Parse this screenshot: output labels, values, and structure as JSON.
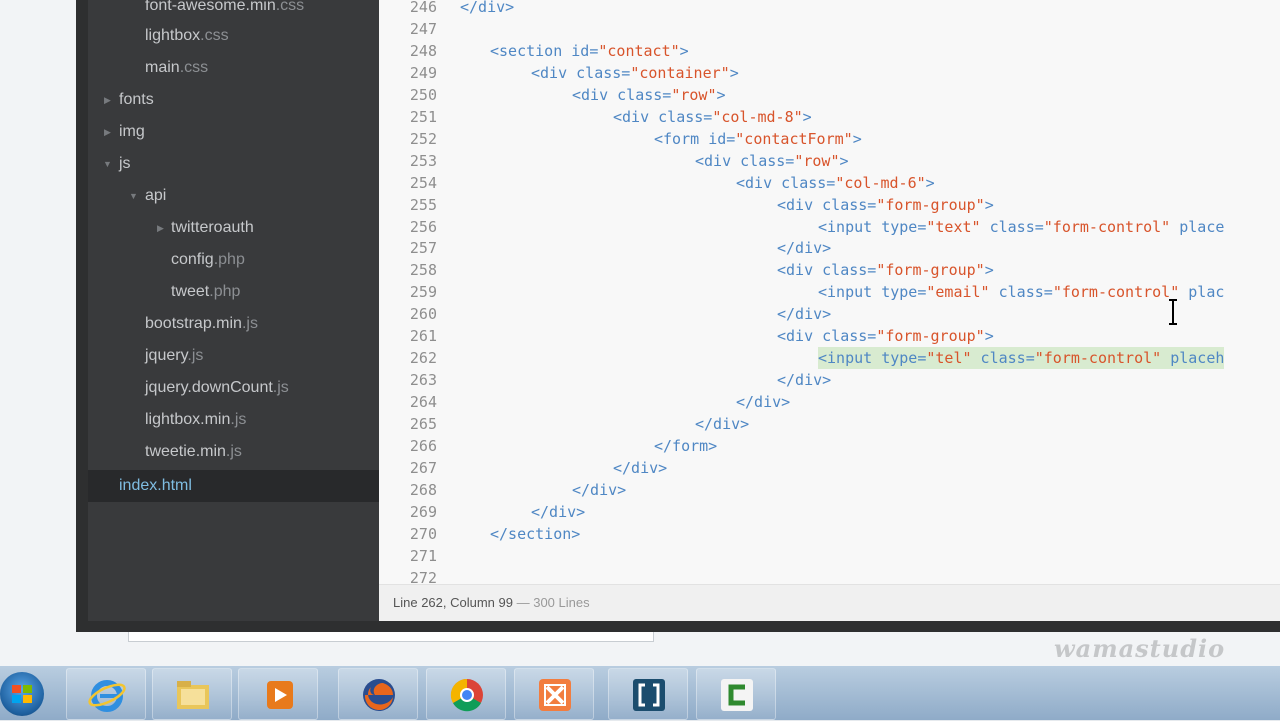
{
  "sidebar": {
    "items": [
      {
        "name": "font-awesome.min",
        "ext": ".css"
      },
      {
        "name": "lightbox",
        "ext": ".css"
      },
      {
        "name": "main",
        "ext": ".css"
      },
      {
        "name": "fonts",
        "ext": ""
      },
      {
        "name": "img",
        "ext": ""
      },
      {
        "name": "js",
        "ext": ""
      },
      {
        "name": "api",
        "ext": ""
      },
      {
        "name": "twitteroauth",
        "ext": ""
      },
      {
        "name": "config",
        "ext": ".php"
      },
      {
        "name": "tweet",
        "ext": ".php"
      },
      {
        "name": "bootstrap.min",
        "ext": ".js"
      },
      {
        "name": "jquery",
        "ext": ".js"
      },
      {
        "name": "jquery.downCount",
        "ext": ".js"
      },
      {
        "name": "lightbox.min",
        "ext": ".js"
      },
      {
        "name": "tweetie.min",
        "ext": ".js"
      },
      {
        "name": "index.html",
        "ext": ""
      }
    ],
    "selected": "index.html"
  },
  "editor": {
    "line_numbers": [
      "246",
      "247",
      "248",
      "249",
      "250",
      "251",
      "252",
      "253",
      "254",
      "255",
      "256",
      "257",
      "258",
      "259",
      "260",
      "261",
      "262",
      "263",
      "264",
      "265",
      "266",
      "267",
      "268",
      "269",
      "270",
      "271",
      "272"
    ],
    "lines": [
      [
        {
          "t": "tag",
          "v": "</div>"
        }
      ],
      [],
      [
        {
          "t": "tag",
          "v": "<section "
        },
        {
          "t": "attr",
          "v": "id="
        },
        {
          "t": "str",
          "v": "\"contact\""
        },
        {
          "t": "tag",
          "v": ">"
        }
      ],
      [
        {
          "t": "tag",
          "v": "<div "
        },
        {
          "t": "attr",
          "v": "class="
        },
        {
          "t": "str",
          "v": "\"container\""
        },
        {
          "t": "tag",
          "v": ">"
        }
      ],
      [
        {
          "t": "tag",
          "v": "<div "
        },
        {
          "t": "attr",
          "v": "class="
        },
        {
          "t": "str",
          "v": "\"row\""
        },
        {
          "t": "tag",
          "v": ">"
        }
      ],
      [
        {
          "t": "tag",
          "v": "<div "
        },
        {
          "t": "attr",
          "v": "class="
        },
        {
          "t": "str",
          "v": "\"col-md-8\""
        },
        {
          "t": "tag",
          "v": ">"
        }
      ],
      [
        {
          "t": "tag",
          "v": "<form "
        },
        {
          "t": "attr",
          "v": "id="
        },
        {
          "t": "str",
          "v": "\"contactForm\""
        },
        {
          "t": "tag",
          "v": ">"
        }
      ],
      [
        {
          "t": "tag",
          "v": "<div "
        },
        {
          "t": "attr",
          "v": "class="
        },
        {
          "t": "str",
          "v": "\"row\""
        },
        {
          "t": "tag",
          "v": ">"
        }
      ],
      [
        {
          "t": "tag",
          "v": "<div "
        },
        {
          "t": "attr",
          "v": "class="
        },
        {
          "t": "str",
          "v": "\"col-md-6\""
        },
        {
          "t": "tag",
          "v": ">"
        }
      ],
      [
        {
          "t": "tag",
          "v": "<div "
        },
        {
          "t": "attr",
          "v": "class="
        },
        {
          "t": "str",
          "v": "\"form-group\""
        },
        {
          "t": "tag",
          "v": ">"
        }
      ],
      [
        {
          "t": "tag",
          "v": "<input "
        },
        {
          "t": "attr",
          "v": "type="
        },
        {
          "t": "str",
          "v": "\"text\""
        },
        {
          "t": "attr",
          "v": " class="
        },
        {
          "t": "str",
          "v": "\"form-control\""
        },
        {
          "t": "attr",
          "v": " place"
        }
      ],
      [
        {
          "t": "tag",
          "v": "</div>"
        }
      ],
      [
        {
          "t": "tag",
          "v": "<div "
        },
        {
          "t": "attr",
          "v": "class="
        },
        {
          "t": "str",
          "v": "\"form-group\""
        },
        {
          "t": "tag",
          "v": ">"
        }
      ],
      [
        {
          "t": "tag",
          "v": "<input "
        },
        {
          "t": "attr",
          "v": "type="
        },
        {
          "t": "str",
          "v": "\"email\""
        },
        {
          "t": "attr",
          "v": " class="
        },
        {
          "t": "str",
          "v": "\"form-control\""
        },
        {
          "t": "attr",
          "v": " plac"
        }
      ],
      [
        {
          "t": "tag",
          "v": "</div>"
        }
      ],
      [
        {
          "t": "tag",
          "v": "<div "
        },
        {
          "t": "attr",
          "v": "class="
        },
        {
          "t": "str",
          "v": "\"form-group\""
        },
        {
          "t": "tag",
          "v": ">"
        }
      ],
      [
        {
          "t": "tag",
          "v": "<input "
        },
        {
          "t": "attr",
          "v": "type="
        },
        {
          "t": "str",
          "v": "\"tel\""
        },
        {
          "t": "attr",
          "v": " class="
        },
        {
          "t": "str",
          "v": "\"form-control\""
        },
        {
          "t": "attr",
          "v": " placeh"
        }
      ],
      [
        {
          "t": "tag",
          "v": "</div>"
        }
      ],
      [
        {
          "t": "tag",
          "v": "</div>"
        }
      ],
      [
        {
          "t": "tag",
          "v": "</div>"
        }
      ],
      [
        {
          "t": "tag",
          "v": "</form>"
        }
      ],
      [
        {
          "t": "tag",
          "v": "</div>"
        }
      ],
      [
        {
          "t": "tag",
          "v": "</div>"
        }
      ],
      [
        {
          "t": "tag",
          "v": "</div>"
        }
      ],
      [
        {
          "t": "tag",
          "v": "</section>"
        }
      ],
      [],
      []
    ],
    "highlighted_line": "262"
  },
  "status": {
    "position": "Line 262, Column 99",
    "separator": " — ",
    "lines": "300 Lines"
  },
  "watermark": "wamastudio",
  "taskbar": {
    "items": [
      "start-orb-icon",
      "internet-explorer-icon",
      "file-explorer-icon",
      "media-player-icon",
      "firefox-icon",
      "chrome-icon",
      "xampp-icon",
      "brackets-icon",
      "camtasia-icon"
    ]
  }
}
